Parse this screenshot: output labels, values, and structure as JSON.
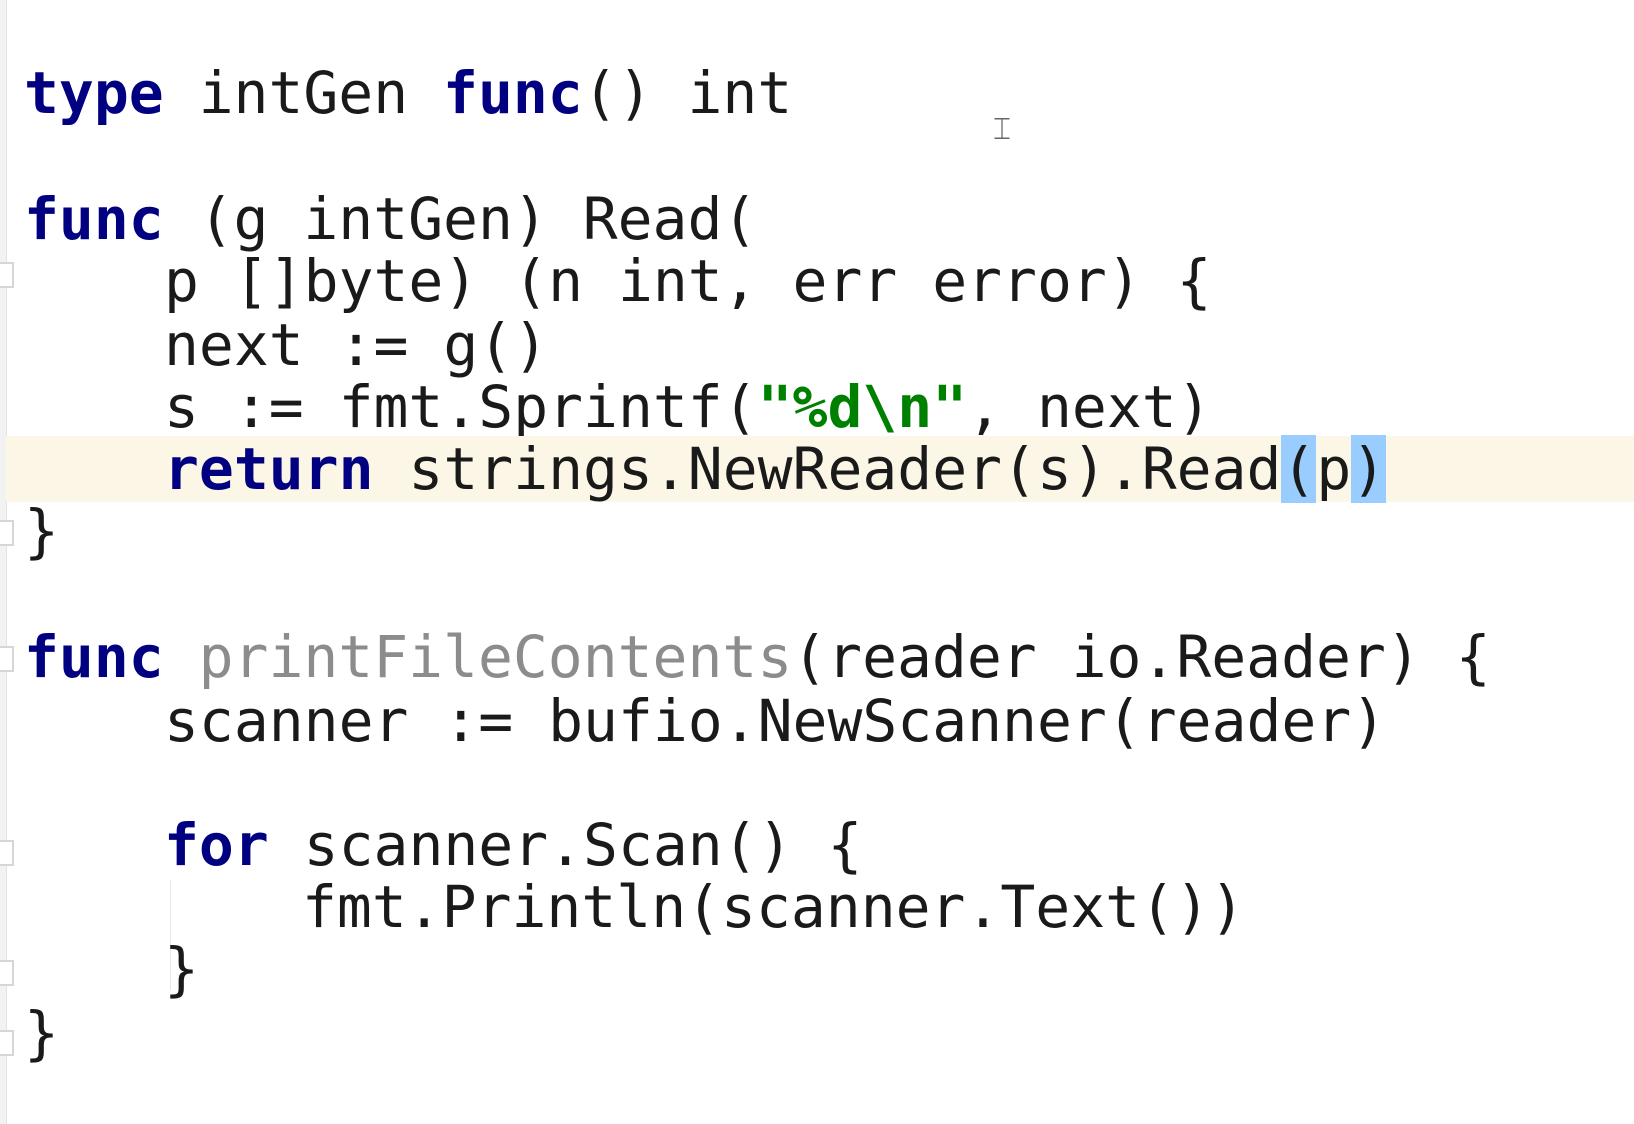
{
  "editor": {
    "language": "go",
    "mouse_cursor_icon": "i-beam-cursor-icon",
    "colors": {
      "keyword": "#000080",
      "string": "#008000",
      "unused_identifier": "#8c8c8c",
      "current_line_highlight": "#fbf6e6",
      "brace_match_highlight": "#99ccff"
    },
    "lines": {
      "l1": {
        "kw1": "type",
        "t1": " intGen ",
        "kw2": "func",
        "t2": "() int"
      },
      "l2": {
        "kw1": "func",
        "t1": " (g intGen) Read("
      },
      "l3": {
        "t1": "p []byte) (n int, err error) {"
      },
      "l4": {
        "t1": "next := g()"
      },
      "l5": {
        "t1": "s := fmt.Sprintf(",
        "str": "\"%d\\n\"",
        "t2": ", next)"
      },
      "l6": {
        "kw1": "return",
        "t1": " strings.NewReader(s).Read",
        "b1": "(",
        "t2": "p",
        "b2": ")"
      },
      "l7": {
        "t1": "}"
      },
      "l8": {
        "kw1": "func",
        "sp": " ",
        "fn": "printFileContents",
        "t1": "(reader io.Reader) {"
      },
      "l9": {
        "t1": "scanner := bufio.NewScanner(reader)"
      },
      "l10": {
        "kw1": "for",
        "t1": " scanner.Scan() {"
      },
      "l11": {
        "t1": "fmt.Println(scanner.Text())"
      },
      "l12": {
        "t1": "}"
      },
      "l13": {
        "t1": "}"
      }
    }
  }
}
